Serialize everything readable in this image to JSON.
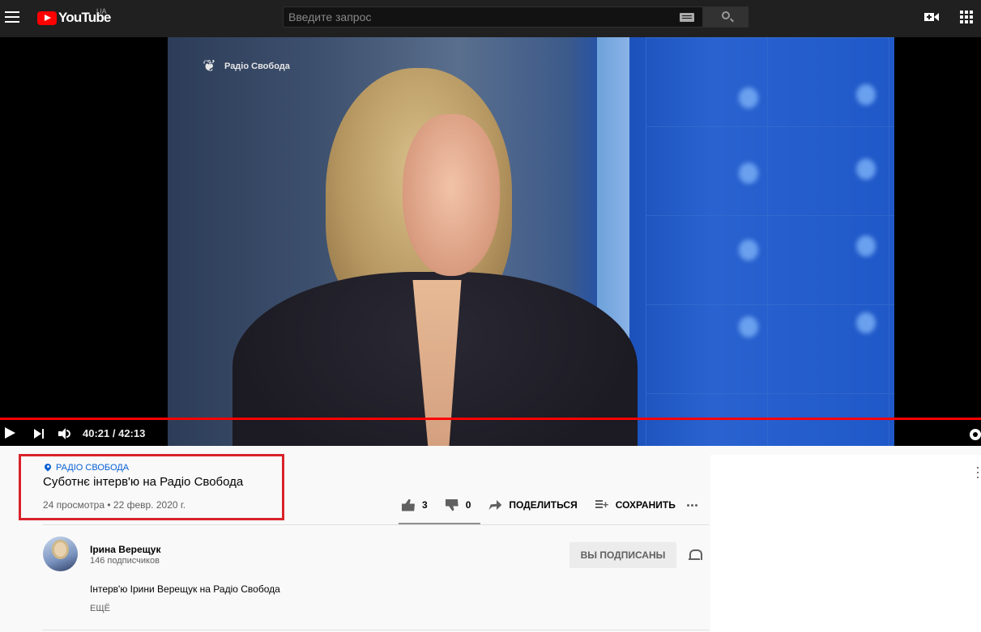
{
  "header": {
    "logo_text": "YouTube",
    "country_code": "UA",
    "search_placeholder": "Введите запрос"
  },
  "player": {
    "current_time": "40:21",
    "duration": "42:13",
    "time_display": "40:21 / 42:13",
    "progress": 0.956,
    "overlay_logo_text": "Радіо Свобода"
  },
  "video": {
    "channel_tag": "РАДІО СВОБОДА",
    "title": "Суботнє інтерв'ю на Радіо Свобода",
    "meta": "24 просмотра • 22 февр. 2020 г.",
    "likes": "3",
    "dislikes": "0",
    "share_label": "ПОДЕЛИТЬСЯ",
    "save_label": "СОХРАНИТЬ"
  },
  "owner": {
    "name": "Ірина Верещук",
    "subscribers": "146 подписчиков",
    "subscribe_label": "ВЫ ПОДПИСАНЫ"
  },
  "description": {
    "text": "Інтерв'ю Ірини Верещук на Радіо Свобода",
    "more_label": "ЕЩЁ"
  },
  "colors": {
    "brand_red": "#ff0000",
    "highlight_box": "#d9222a",
    "link_blue": "#065fd4"
  }
}
